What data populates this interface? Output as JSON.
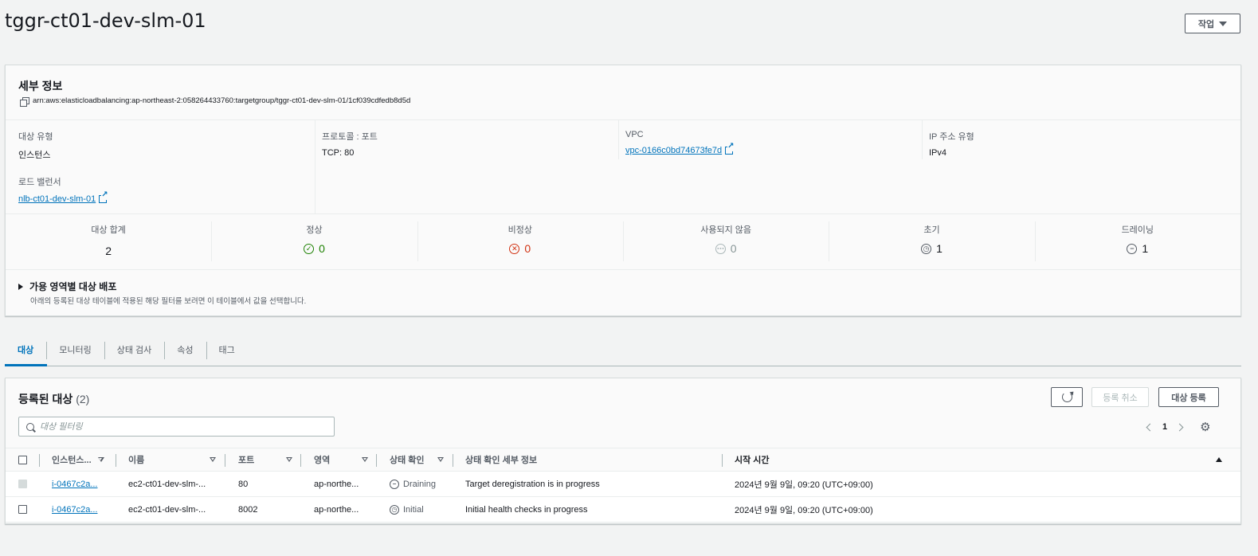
{
  "page": {
    "title": "tggr-ct01-dev-slm-01",
    "actions_label": "작업"
  },
  "details": {
    "heading": "세부 정보",
    "arn": "arn:aws:elasticloadbalancing:ap-northeast-2:058264433760:targetgroup/tggr-ct01-dev-slm-01/1cf039cdfedb8d5d",
    "target_type_label": "대상 유형",
    "target_type_value": "인스턴스",
    "load_balancer_label": "로드 밸런서",
    "load_balancer_value": "nlb-ct01-dev-slm-01",
    "protocol_label": "프로토콜 : 포트",
    "protocol_value": "TCP: 80",
    "vpc_label": "VPC",
    "vpc_value": "vpc-0166c0bd74673fe7d",
    "ip_type_label": "IP 주소 유형",
    "ip_type_value": "IPv4"
  },
  "stats": [
    {
      "label": "대상 합계",
      "value": "2",
      "icon": "none",
      "color": "#16191f"
    },
    {
      "label": "정상",
      "value": "0",
      "icon": "check-circle-icon",
      "color": "#1d8102"
    },
    {
      "label": "비정상",
      "value": "0",
      "icon": "x-circle-icon",
      "color": "#d13212"
    },
    {
      "label": "사용되지 않음",
      "value": "0",
      "icon": "ellipsis-circle-icon",
      "color": "#aab7b8"
    },
    {
      "label": "초기",
      "value": "1",
      "icon": "clock-icon",
      "color": "#16191f"
    },
    {
      "label": "드레이닝",
      "value": "1",
      "icon": "minus-circle-icon",
      "color": "#16191f"
    }
  ],
  "az": {
    "title": "가용 영역별 대상 배포",
    "description": "아래의 등록된 대상 테이블에 적용된 해당 필터를 보려면 이 테이블에서 값을 선택합니다."
  },
  "tabs": [
    "대상",
    "모니터링",
    "상태 검사",
    "속성",
    "태그"
  ],
  "targets": {
    "title": "등록된 대상",
    "count": "(2)",
    "deregister_label": "등록 취소",
    "register_label": "대상 등록",
    "filter_placeholder": "대상 필터링",
    "page_number": "1",
    "columns": {
      "instance": "인스턴스...",
      "name": "이름",
      "port": "포트",
      "zone": "영역",
      "health": "상태 확인",
      "health_details": "상태 확인 세부 정보",
      "start_time": "시작 시간"
    },
    "rows": [
      {
        "instance": "i-0467c2a...",
        "name": "ec2-ct01-dev-slm-...",
        "port": "80",
        "zone": "ap-northe...",
        "health": "Draining",
        "health_details": "Target deregistration is in progress",
        "start_time": "2024년 9월 9일, 09:20 (UTC+09:00)"
      },
      {
        "instance": "i-0467c2a...",
        "name": "ec2-ct01-dev-slm-...",
        "port": "8002",
        "zone": "ap-northe...",
        "health": "Initial",
        "health_details": "Initial health checks in progress",
        "start_time": "2024년 9월 9일, 09:20 (UTC+09:00)"
      }
    ]
  }
}
